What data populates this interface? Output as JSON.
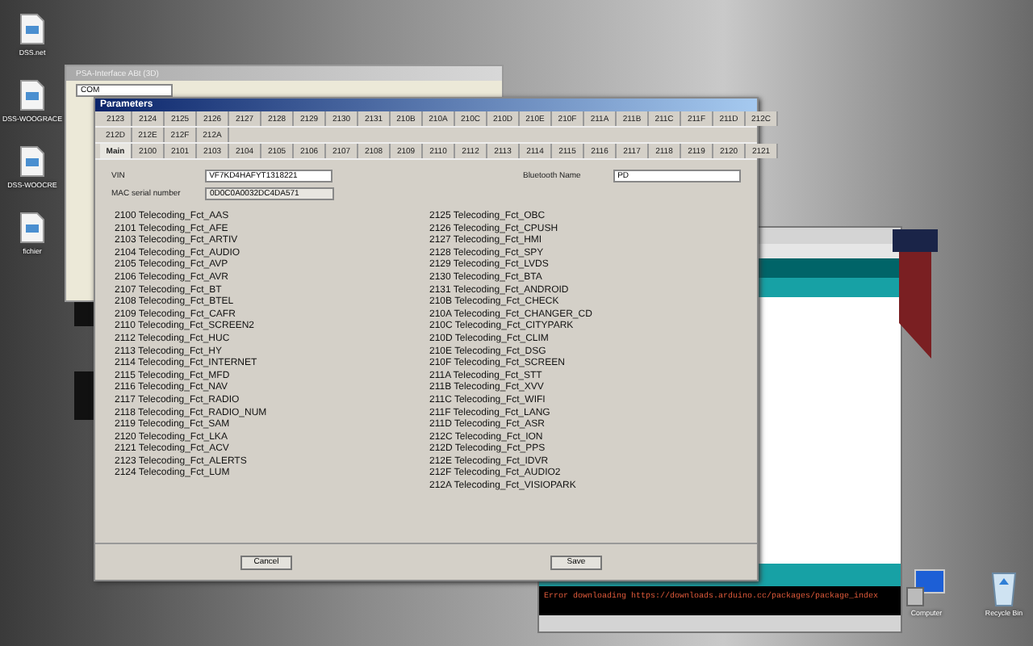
{
  "desktop_icons": [
    {
      "label": "DSS.net"
    },
    {
      "label": "DSS-WOOGRACE"
    },
    {
      "label": "DSS-WOOCRE"
    },
    {
      "label": "fichier"
    }
  ],
  "background_window": {
    "title": "PSA-Interface ABt (3D)",
    "field": "COM"
  },
  "dialog": {
    "title": "Parameters",
    "tab_rows": [
      [
        {
          "label": "2123",
          "selected": false
        },
        {
          "label": "2124",
          "selected": false
        },
        {
          "label": "2125",
          "selected": false
        },
        {
          "label": "2126",
          "selected": false
        },
        {
          "label": "2127",
          "selected": false
        },
        {
          "label": "2128",
          "selected": false
        },
        {
          "label": "2129",
          "selected": false
        },
        {
          "label": "2130",
          "selected": false
        },
        {
          "label": "2131",
          "selected": false
        },
        {
          "label": "210B",
          "selected": false
        },
        {
          "label": "210A",
          "selected": false
        },
        {
          "label": "210C",
          "selected": false
        },
        {
          "label": "210D",
          "selected": false
        },
        {
          "label": "210E",
          "selected": false
        },
        {
          "label": "210F",
          "selected": false
        },
        {
          "label": "211A",
          "selected": false
        },
        {
          "label": "211B",
          "selected": false
        },
        {
          "label": "211C",
          "selected": false
        },
        {
          "label": "211F",
          "selected": false
        },
        {
          "label": "211D",
          "selected": false
        },
        {
          "label": "212C",
          "selected": false
        }
      ],
      [
        {
          "label": "212D",
          "selected": false
        },
        {
          "label": "212E",
          "selected": false
        },
        {
          "label": "212F",
          "selected": false
        },
        {
          "label": "212A",
          "selected": false
        }
      ],
      [
        {
          "label": "Main",
          "selected": true
        },
        {
          "label": "2100",
          "selected": false
        },
        {
          "label": "2101",
          "selected": false
        },
        {
          "label": "2103",
          "selected": false
        },
        {
          "label": "2104",
          "selected": false
        },
        {
          "label": "2105",
          "selected": false
        },
        {
          "label": "2106",
          "selected": false
        },
        {
          "label": "2107",
          "selected": false
        },
        {
          "label": "2108",
          "selected": false
        },
        {
          "label": "2109",
          "selected": false
        },
        {
          "label": "2110",
          "selected": false
        },
        {
          "label": "2112",
          "selected": false
        },
        {
          "label": "2113",
          "selected": false
        },
        {
          "label": "2114",
          "selected": false
        },
        {
          "label": "2115",
          "selected": false
        },
        {
          "label": "2116",
          "selected": false
        },
        {
          "label": "2117",
          "selected": false
        },
        {
          "label": "2118",
          "selected": false
        },
        {
          "label": "2119",
          "selected": false
        },
        {
          "label": "2120",
          "selected": false
        },
        {
          "label": "2121",
          "selected": false
        }
      ]
    ],
    "vin": {
      "label": "VIN",
      "value": "VF7KD4HAFYT1318221"
    },
    "mac": {
      "label": "MAC serial number",
      "value": "0D0C0A0032DC4DA571"
    },
    "bluetooth": {
      "label": "Bluetooth Name",
      "value": "PD"
    },
    "columns": [
      [
        "2100 Telecoding_Fct_AAS",
        "2101 Telecoding_Fct_AFE",
        "2103 Telecoding_Fct_ARTIV",
        "2104 Telecoding_Fct_AUDIO",
        "2105 Telecoding_Fct_AVP",
        "2106 Telecoding_Fct_AVR",
        "2107 Telecoding_Fct_BT",
        "2108 Telecoding_Fct_BTEL",
        "2109 Telecoding_Fct_CAFR",
        "2110 Telecoding_Fct_SCREEN2",
        "2112 Telecoding_Fct_HUC",
        "2113 Telecoding_Fct_HY",
        "2114 Telecoding_Fct_INTERNET",
        "2115 Telecoding_Fct_MFD",
        "2116 Telecoding_Fct_NAV",
        "2117 Telecoding_Fct_RADIO",
        "2118 Telecoding_Fct_RADIO_NUM",
        "2119 Telecoding_Fct_SAM",
        "2120 Telecoding_Fct_LKA",
        "2121 Telecoding_Fct_ACV",
        "2123 Telecoding_Fct_ALERTS",
        "2124 Telecoding_Fct_LUM"
      ],
      [
        "2125 Telecoding_Fct_OBC",
        "2126 Telecoding_Fct_CPUSH",
        "2127 Telecoding_Fct_HMI",
        "2128 Telecoding_Fct_SPY",
        "2129 Telecoding_Fct_LVDS",
        "2130 Telecoding_Fct_BTA",
        "2131 Telecoding_Fct_ANDROID",
        "210B Telecoding_Fct_CHECK",
        "210A Telecoding_Fct_CHANGER_CD",
        "210C Telecoding_Fct_CITYPARK",
        "210D Telecoding_Fct_CLIM",
        "210E Telecoding_Fct_DSG",
        "210F Telecoding_Fct_SCREEN",
        "211A Telecoding_Fct_STT",
        "211B Telecoding_Fct_XVV",
        "211C Telecoding_Fct_WIFI",
        "211F Telecoding_Fct_LANG",
        "211D Telecoding_Fct_ASR",
        "212C Telecoding_Fct_ION",
        "212D Telecoding_Fct_PPS",
        "212E Telecoding_Fct_IDVR",
        "212F Telecoding_Fct_AUDIO2",
        "212A Telecoding_Fct_VISIOPARK"
      ]
    ],
    "buttons": [
      "Cancel",
      "Save"
    ]
  },
  "console": {
    "text": "Error downloading https://downloads.arduino.cc/packages/package_index"
  },
  "system_icons": [
    {
      "label": "Computer",
      "kind": "computer"
    },
    {
      "label": "Recycle Bin",
      "kind": "bin"
    }
  ]
}
